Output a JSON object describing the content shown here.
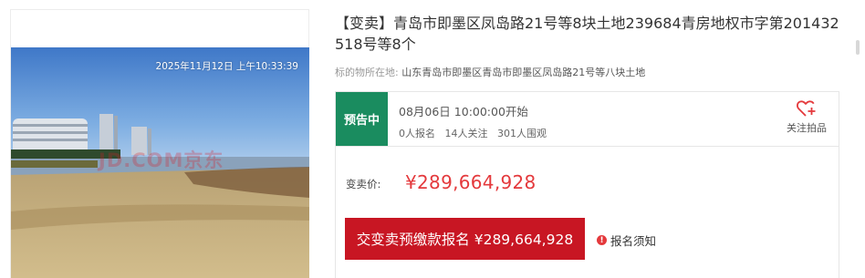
{
  "photo": {
    "timestamp": "2025年11月12日 上午10:33:39",
    "watermark": "JD.COM京东"
  },
  "lot": {
    "title": "【变卖】青岛市即墨区凤岛路21号等8块土地239684青房地权市字第201432518号等8个",
    "subject_label": "标的物所在地:",
    "subject_value": "山东青岛市即墨区青岛市即墨区凤岛路21号等八块土地"
  },
  "status": {
    "badge": "预告中",
    "start_time": "08月06日 10:00:00开始",
    "signups": "0人报名",
    "followers": "14人关注",
    "viewers": "301人围观",
    "follow_label": "关注拍品"
  },
  "price": {
    "label": "变卖价:",
    "value": "¥289,664,928"
  },
  "actions": {
    "signup_button": "交变卖预缴款报名 ¥289,664,928",
    "notice_label": "报名须知"
  },
  "colors": {
    "badge_green": "#1a8c5f",
    "price_red": "#e4393c",
    "button_red": "#c81623"
  },
  "icons": {
    "follow": "heart-plus-icon",
    "notice": "exclamation-icon"
  }
}
